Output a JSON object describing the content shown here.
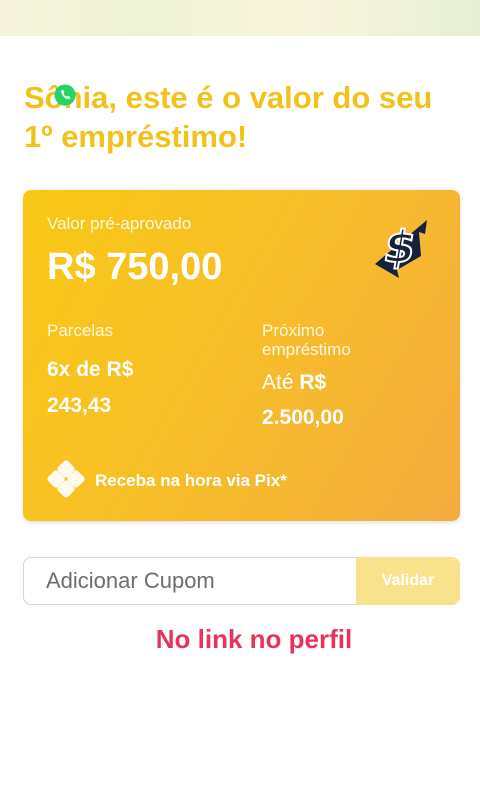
{
  "headline": "Sônia, este é o valor do seu 1º empréstimo!",
  "card": {
    "pre_approved_label": "Valor pré-aprovado",
    "amount": "R$ 750,00",
    "installments_label": "Parcelas",
    "installments_value_line1": "6x de R$",
    "installments_value_line2": "243,43",
    "next_loan_label": "Próximo empréstimo",
    "next_loan_prefix": "Até",
    "next_loan_currency": "R$",
    "next_loan_value": "2.500,00",
    "pix_text": "Receba na hora via Pix*"
  },
  "coupon": {
    "placeholder": "Adicionar Cupom",
    "button_label": "Validar"
  },
  "footer_note": "No link no perfil",
  "colors": {
    "headline": "#f2c21a",
    "card_start": "#f8c815",
    "card_end": "#f4ac3e",
    "button": "#f8e28c",
    "footer_note": "#e8335a"
  },
  "icons": [
    "whatsapp-icon",
    "dollar-logo-icon",
    "pix-icon"
  ]
}
